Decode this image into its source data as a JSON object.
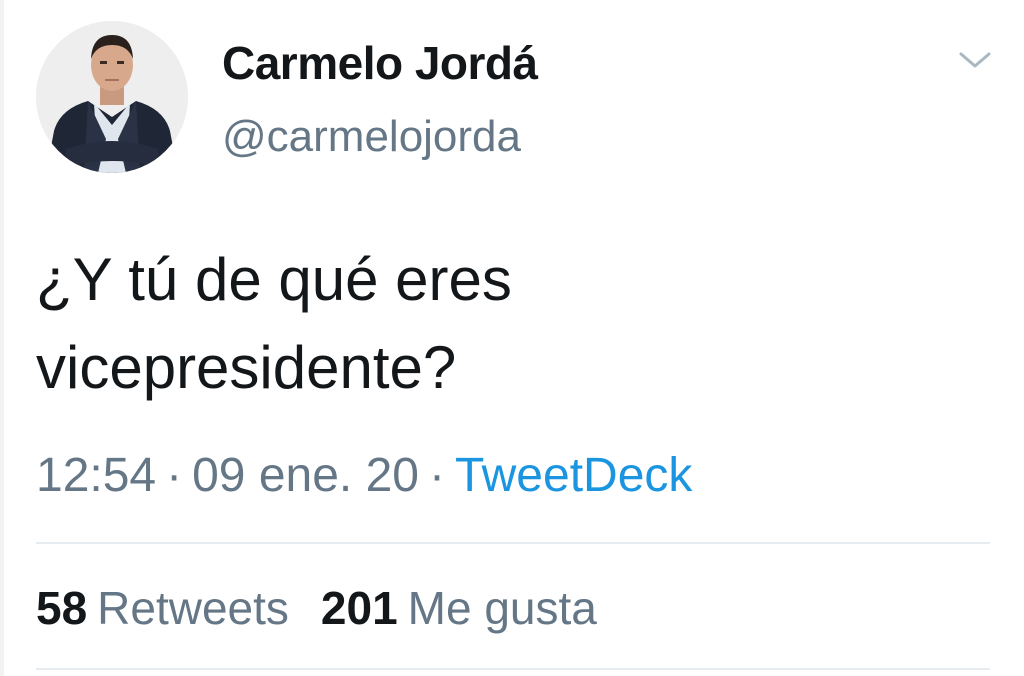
{
  "tweet": {
    "author": {
      "name": "Carmelo Jordá",
      "handle": "@carmelojorda"
    },
    "text_line1": "¿Y tú de qué eres",
    "text_line2": "vicepresidente?",
    "time": "12:54",
    "date": "09 ene. 20",
    "separator": "·",
    "source": "TweetDeck",
    "retweets": {
      "count": "58",
      "label": "Retweets"
    },
    "likes": {
      "count": "201",
      "label": "Me gusta"
    }
  },
  "colors": {
    "text": "#14171a",
    "secondary": "#657786",
    "link": "#1b95e0",
    "divider": "#e6ecf0"
  },
  "icons": {
    "menu": "chevron-down-icon"
  }
}
